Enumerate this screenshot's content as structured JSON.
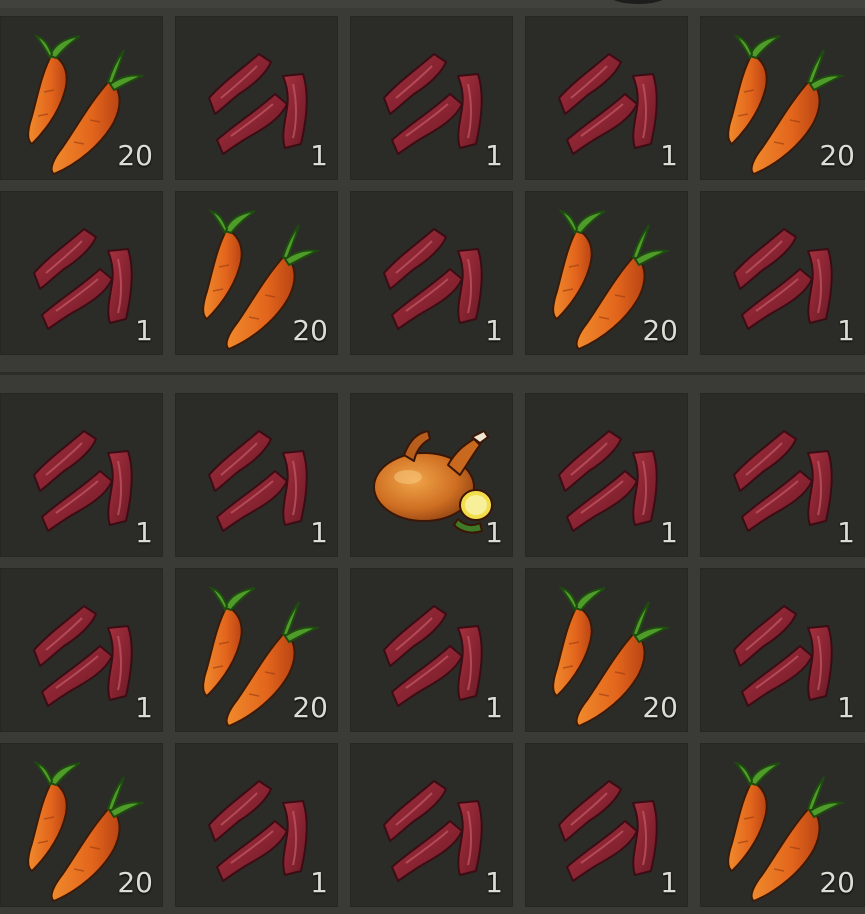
{
  "colors": {
    "slot_bg": "#2b2c28",
    "panel_bg": "#3a3b36",
    "quantity_text": "#dcdcd4"
  },
  "item_icons": {
    "carrot": "carrot-icon",
    "bacon": "bacon-icon",
    "chicken": "roast-chicken-icon"
  },
  "top_grid": {
    "rows": [
      [
        {
          "item": "carrot",
          "qty": "20"
        },
        {
          "item": "bacon",
          "qty": "1"
        },
        {
          "item": "bacon",
          "qty": "1"
        },
        {
          "item": "bacon",
          "qty": "1"
        },
        {
          "item": "carrot",
          "qty": "20"
        }
      ],
      [
        {
          "item": "bacon",
          "qty": "1"
        },
        {
          "item": "carrot",
          "qty": "20"
        },
        {
          "item": "bacon",
          "qty": "1"
        },
        {
          "item": "carrot",
          "qty": "20"
        },
        {
          "item": "bacon",
          "qty": "1"
        }
      ]
    ]
  },
  "bottom_grid": {
    "rows": [
      [
        {
          "item": "bacon",
          "qty": "1"
        },
        {
          "item": "bacon",
          "qty": "1"
        },
        {
          "item": "chicken",
          "qty": "1"
        },
        {
          "item": "bacon",
          "qty": "1"
        },
        {
          "item": "bacon",
          "qty": "1"
        }
      ],
      [
        {
          "item": "bacon",
          "qty": "1"
        },
        {
          "item": "carrot",
          "qty": "20"
        },
        {
          "item": "bacon",
          "qty": "1"
        },
        {
          "item": "carrot",
          "qty": "20"
        },
        {
          "item": "bacon",
          "qty": "1"
        }
      ],
      [
        {
          "item": "carrot",
          "qty": "20"
        },
        {
          "item": "bacon",
          "qty": "1"
        },
        {
          "item": "bacon",
          "qty": "1"
        },
        {
          "item": "bacon",
          "qty": "1"
        },
        {
          "item": "carrot",
          "qty": "20"
        }
      ]
    ]
  }
}
